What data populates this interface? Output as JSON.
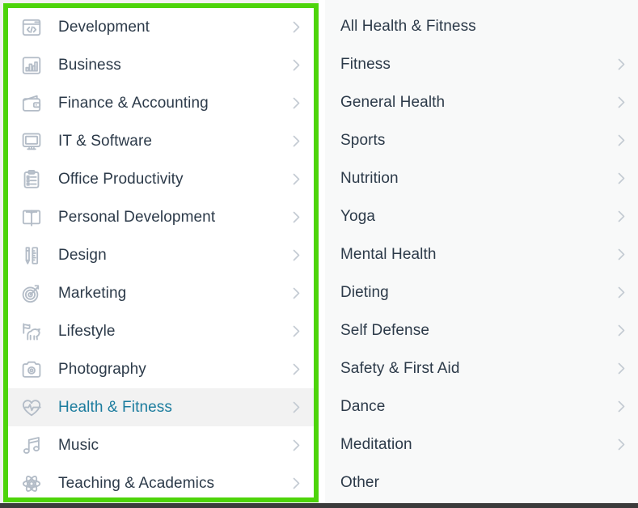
{
  "theme": {
    "highlight_border_color": "#4dd40a",
    "active_text_color": "#1b7c9e",
    "active_row_background": "#f2f2f2",
    "primary_panel_background": "#ffffff",
    "secondary_panel_background": "#f8f9f9",
    "text_color": "#2c3a49",
    "icon_color": "#b3bcc7",
    "chevron_color": "#c4cbd3",
    "page_background": "#f1f1f1",
    "bottom_bar_color": "#3b3b3b"
  },
  "primary_menu": {
    "name": "category-menu",
    "items": [
      {
        "label": "Development",
        "icon": "code-window-icon",
        "has_chevron": true,
        "active": false
      },
      {
        "label": "Business",
        "icon": "bar-chart-icon",
        "has_chevron": true,
        "active": false
      },
      {
        "label": "Finance & Accounting",
        "icon": "wallet-icon",
        "has_chevron": true,
        "active": false
      },
      {
        "label": "IT & Software",
        "icon": "monitor-icon",
        "has_chevron": true,
        "active": false
      },
      {
        "label": "Office Productivity",
        "icon": "clipboard-list-icon",
        "has_chevron": true,
        "active": false
      },
      {
        "label": "Personal Development",
        "icon": "open-book-icon",
        "has_chevron": true,
        "active": false
      },
      {
        "label": "Design",
        "icon": "pencil-ruler-icon",
        "has_chevron": true,
        "active": false
      },
      {
        "label": "Marketing",
        "icon": "target-dart-icon",
        "has_chevron": true,
        "active": false
      },
      {
        "label": "Lifestyle",
        "icon": "dog-icon",
        "has_chevron": true,
        "active": false
      },
      {
        "label": "Photography",
        "icon": "camera-icon",
        "has_chevron": true,
        "active": false
      },
      {
        "label": "Health & Fitness",
        "icon": "heart-pulse-icon",
        "has_chevron": true,
        "active": true
      },
      {
        "label": "Music",
        "icon": "music-note-icon",
        "has_chevron": true,
        "active": false
      },
      {
        "label": "Teaching & Academics",
        "icon": "atom-icon",
        "has_chevron": true,
        "active": false
      }
    ]
  },
  "secondary_menu": {
    "name": "health-and-fitness-subcategory-menu",
    "items": [
      {
        "label": "All Health & Fitness",
        "has_chevron": false
      },
      {
        "label": "Fitness",
        "has_chevron": true
      },
      {
        "label": "General Health",
        "has_chevron": true
      },
      {
        "label": "Sports",
        "has_chevron": true
      },
      {
        "label": "Nutrition",
        "has_chevron": true
      },
      {
        "label": "Yoga",
        "has_chevron": true
      },
      {
        "label": "Mental Health",
        "has_chevron": true
      },
      {
        "label": "Dieting",
        "has_chevron": true
      },
      {
        "label": "Self Defense",
        "has_chevron": true
      },
      {
        "label": "Safety & First Aid",
        "has_chevron": true
      },
      {
        "label": "Dance",
        "has_chevron": true
      },
      {
        "label": "Meditation",
        "has_chevron": true
      },
      {
        "label": "Other",
        "has_chevron": false
      }
    ]
  }
}
